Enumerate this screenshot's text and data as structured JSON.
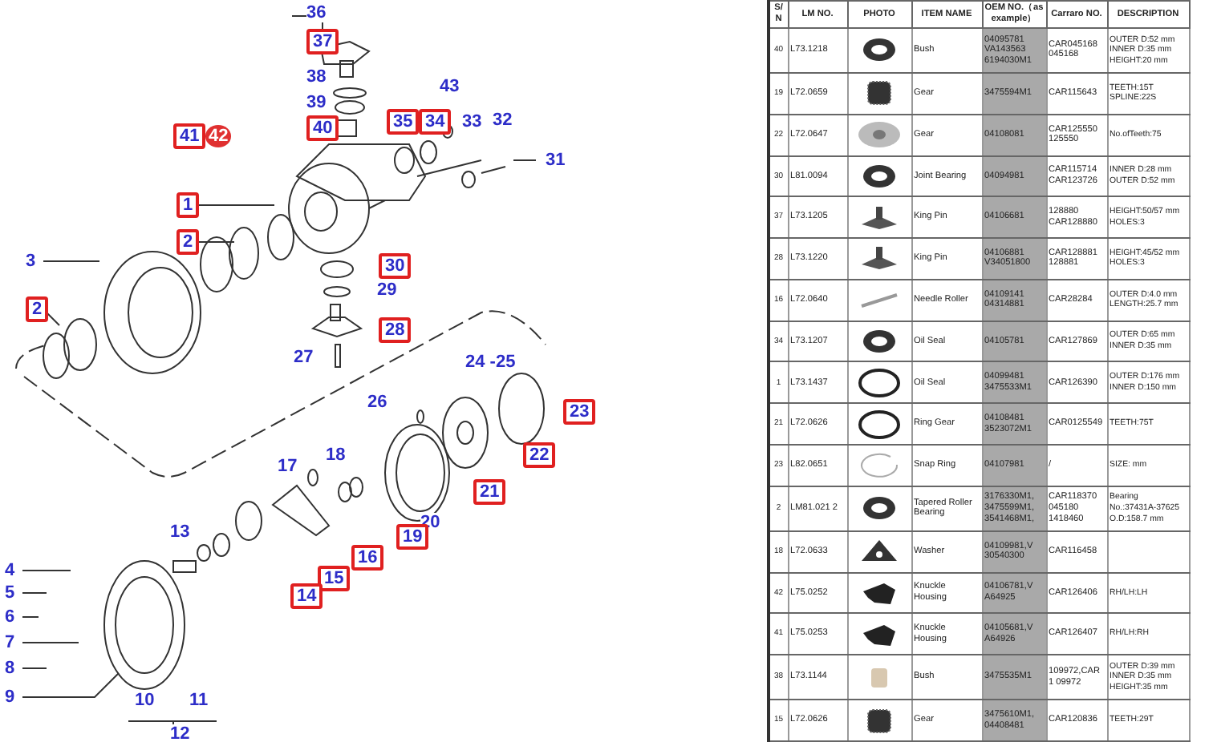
{
  "diagram": {
    "callouts": [
      {
        "label": "36",
        "kind": "plain"
      },
      {
        "label": "37",
        "kind": "boxed"
      },
      {
        "label": "38",
        "kind": "plain"
      },
      {
        "label": "39",
        "kind": "plain"
      },
      {
        "label": "40",
        "kind": "boxed"
      },
      {
        "label": "41",
        "kind": "boxed"
      },
      {
        "label": "42",
        "kind": "circled"
      },
      {
        "label": "35",
        "kind": "boxed"
      },
      {
        "label": "34",
        "kind": "boxed"
      },
      {
        "label": "43",
        "kind": "plain"
      },
      {
        "label": "33",
        "kind": "plain"
      },
      {
        "label": "32",
        "kind": "plain"
      },
      {
        "label": "31",
        "kind": "plain"
      },
      {
        "label": "1",
        "kind": "boxed"
      },
      {
        "label": "2",
        "kind": "boxed"
      },
      {
        "label": "3",
        "kind": "plain"
      },
      {
        "label": "2",
        "kind": "boxed"
      },
      {
        "label": "30",
        "kind": "boxed"
      },
      {
        "label": "29",
        "kind": "plain"
      },
      {
        "label": "28",
        "kind": "boxed"
      },
      {
        "label": "27",
        "kind": "plain"
      },
      {
        "label": "24 -25",
        "kind": "plain"
      },
      {
        "label": "26",
        "kind": "plain"
      },
      {
        "label": "23",
        "kind": "boxed"
      },
      {
        "label": "22",
        "kind": "boxed"
      },
      {
        "label": "21",
        "kind": "boxed"
      },
      {
        "label": "20",
        "kind": "plain"
      },
      {
        "label": "19",
        "kind": "boxed"
      },
      {
        "label": "18",
        "kind": "plain"
      },
      {
        "label": "17",
        "kind": "plain"
      },
      {
        "label": "16",
        "kind": "boxed"
      },
      {
        "label": "15",
        "kind": "boxed"
      },
      {
        "label": "14",
        "kind": "boxed"
      },
      {
        "label": "13",
        "kind": "plain"
      },
      {
        "label": "4",
        "kind": "plain"
      },
      {
        "label": "5",
        "kind": "plain"
      },
      {
        "label": "6",
        "kind": "plain"
      },
      {
        "label": "7",
        "kind": "plain"
      },
      {
        "label": "8",
        "kind": "plain"
      },
      {
        "label": "9",
        "kind": "plain"
      },
      {
        "label": "10",
        "kind": "plain"
      },
      {
        "label": "11",
        "kind": "plain"
      },
      {
        "label": "12",
        "kind": "plain"
      }
    ]
  },
  "table": {
    "columns": [
      "S/ N",
      "LM NO.",
      "PHOTO",
      "ITEM NAME",
      "OEM NO.（as example）",
      "Carraro NO.",
      "DESCRIPTION"
    ],
    "rows": [
      {
        "sn": "40",
        "lm": "L73.1218",
        "kind": "ring",
        "name": "Bush",
        "oem": "04095781 VA143563 6194030M1",
        "carraro": "CAR045168 045168",
        "description": [
          "OUTER D:52 mm",
          "INNER D:35 mm",
          "HEIGHT:20 mm"
        ]
      },
      {
        "sn": "19",
        "lm": "L72.0659",
        "kind": "gear",
        "name": "Gear",
        "oem": "3475594M1",
        "carraro": "CAR115643",
        "description": [
          "TEETH:15T",
          "SPLINE:22S"
        ]
      },
      {
        "sn": "22",
        "lm": "L72.0647",
        "kind": "disc",
        "name": "Gear",
        "oem": "04108081",
        "carraro": "CAR125550 125550",
        "description": [
          "No.ofTeeth:75"
        ]
      },
      {
        "sn": "30",
        "lm": "L81.0094",
        "kind": "ring",
        "name": "Joint Bearing",
        "oem": "04094981",
        "carraro": "CAR115714 CAR123726",
        "description": [
          "INNER D:28 mm",
          "OUTER D:52 mm"
        ]
      },
      {
        "sn": "37",
        "lm": "L73.1205",
        "kind": "pin",
        "name": "King Pin",
        "oem": "04106681",
        "carraro": "128880 CAR128880",
        "description": [
          "HEIGHT:50/57 mm",
          "HOLES:3"
        ]
      },
      {
        "sn": "28",
        "lm": "L73.1220",
        "kind": "pin",
        "name": "King Pin",
        "oem": "04106881 V34051800",
        "carraro": "CAR128881 128881",
        "description": [
          "HEIGHT:45/52 mm",
          "HOLES:3"
        ]
      },
      {
        "sn": "16",
        "lm": "L72.0640",
        "kind": "roller",
        "name": "Needle Roller",
        "oem": "04109141 04314881",
        "carraro": "CAR28284",
        "description": [
          "OUTER D:4.0 mm",
          "LENGTH:25.7 mm"
        ]
      },
      {
        "sn": "34",
        "lm": "L73.1207",
        "kind": "ring",
        "name": "Oil Seal",
        "oem": "04105781",
        "carraro": "CAR127869",
        "description": [
          "OUTER D:65 mm",
          "INNER D:35 mm"
        ]
      },
      {
        "sn": "1",
        "lm": "L73.1437",
        "kind": "oring",
        "name": "Oil Seal",
        "oem": "04099481 3475533M1",
        "carraro": "CAR126390",
        "description": [
          "OUTER D:176 mm",
          "INNER D:150 mm"
        ]
      },
      {
        "sn": "21",
        "lm": "L72.0626",
        "kind": "oring",
        "name": "Ring Gear",
        "oem": "04108481 3523072M1",
        "carraro": "CAR0125549",
        "description": [
          "TEETH:75T"
        ]
      },
      {
        "sn": "23",
        "lm": "L82.0651",
        "kind": "snap",
        "name": "Snap Ring",
        "oem": "04107981",
        "carraro": "/",
        "description": [
          "SIZE: mm"
        ]
      },
      {
        "sn": "2",
        "lm": "LM81.021 2",
        "kind": "ring",
        "name": "Tapered Roller Bearing",
        "oem": "3176330M1, 3475599M1, 3541468M1,",
        "carraro": "CAR118370 045180 1418460",
        "description": [
          "Bearing No.:37431A-37625",
          "O.D:158.7 mm"
        ]
      },
      {
        "sn": "18",
        "lm": "L72.0633",
        "kind": "washer",
        "name": "Washer",
        "oem": "04109981,V 30540300",
        "carraro": "CAR116458",
        "description": []
      },
      {
        "sn": "42",
        "lm": "L75.0252",
        "kind": "housing",
        "name": "Knuckle Housing",
        "oem": "04106781,V A64925",
        "carraro": "CAR126406",
        "description": [
          "RH/LH:LH"
        ]
      },
      {
        "sn": "41",
        "lm": "L75.0253",
        "kind": "housing",
        "name": "Knuckle Housing",
        "oem": "04105681,V A64926",
        "carraro": "CAR126407",
        "description": [
          "RH/LH:RH"
        ]
      },
      {
        "sn": "38",
        "lm": "L73.1144",
        "kind": "sleeve",
        "name": "Bush",
        "oem": "3475535M1",
        "carraro": "109972,CAR1 09972",
        "description": [
          "OUTER D:39 mm",
          "INNER D:35 mm",
          "HEIGHT:35 mm"
        ]
      },
      {
        "sn": "15",
        "lm": "L72.0626",
        "kind": "gear",
        "name": "Gear",
        "oem": "3475610M1, 04408481",
        "carraro": "CAR120836",
        "description": [
          "TEETH:29T"
        ]
      }
    ]
  }
}
